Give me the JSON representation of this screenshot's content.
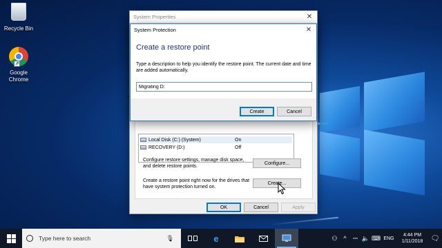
{
  "desktop": {
    "icons": [
      {
        "label": "Recycle Bin"
      },
      {
        "label": "Google Chrome"
      }
    ]
  },
  "system_properties": {
    "title": "System Properties",
    "drives": [
      {
        "name": "Local Disk (C:) (System)",
        "protection": "On"
      },
      {
        "name": "RECOVERY (D:)",
        "protection": "Off"
      }
    ],
    "configure_text": "Configure restore settings, manage disk space, and delete restore points.",
    "configure_button": "Configure...",
    "create_text": "Create a restore point right now for the drives that have system protection turned on.",
    "create_button": "Create...",
    "ok_button": "OK",
    "cancel_button": "Cancel",
    "apply_button": "Apply"
  },
  "system_protection": {
    "title": "System Protection",
    "heading": "Create a restore point",
    "description": "Type a description to help you identify the restore point. The current date and time are added automatically.",
    "input_value": "Migrating D:",
    "create_button": "Create",
    "cancel_button": "Cancel",
    "heading_color": "#1e3287"
  },
  "taskbar": {
    "search_placeholder": "Type here to search",
    "apps": [
      "task-view-icon",
      "edge-icon",
      "file-explorer-icon",
      "mail-icon",
      "system-properties-icon"
    ],
    "language": "ENG",
    "time": "4:44 PM",
    "date": "1/11/2018"
  }
}
